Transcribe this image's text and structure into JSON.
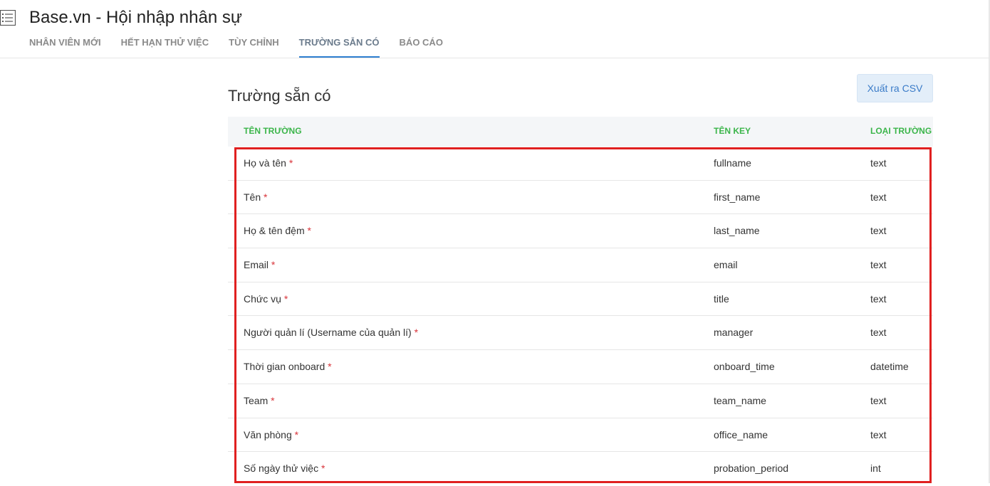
{
  "app": {
    "title": "Base.vn - Hội nhập nhân sự"
  },
  "tabs": [
    {
      "label": "NHÂN VIÊN MỚI"
    },
    {
      "label": "HẾT HẠN THỬ VIỆC"
    },
    {
      "label": "TÙY CHỈNH"
    },
    {
      "label": "TRƯỜNG SẴN CÓ",
      "active": true
    },
    {
      "label": "BÁO CÁO"
    }
  ],
  "page": {
    "title": "Trường sẵn có",
    "export_button": "Xuất ra CSV"
  },
  "table": {
    "headers": {
      "name": "TÊN TRƯỜNG",
      "key": "TÊN KEY",
      "type": "LOẠI TRƯỜNG"
    },
    "required_mark": "*",
    "rows": [
      {
        "name": "Họ và tên",
        "key": "fullname",
        "type": "text"
      },
      {
        "name": "Tên",
        "key": "first_name",
        "type": "text"
      },
      {
        "name": "Họ & tên đệm",
        "key": "last_name",
        "type": "text"
      },
      {
        "name": "Email",
        "key": "email",
        "type": "text"
      },
      {
        "name": "Chức vụ",
        "key": "title",
        "type": "text"
      },
      {
        "name": "Người quản lí (Username của quản lí)",
        "key": "manager",
        "type": "text"
      },
      {
        "name": "Thời gian onboard",
        "key": "onboard_time",
        "type": "datetime"
      },
      {
        "name": "Team",
        "key": "team_name",
        "type": "text"
      },
      {
        "name": "Văn phòng",
        "key": "office_name",
        "type": "text"
      },
      {
        "name": "Số ngày thử việc",
        "key": "probation_period",
        "type": "int"
      }
    ]
  },
  "colors": {
    "header_text": "#3bb54a",
    "required": "#d9343a",
    "active_tab_underline": "#2e7fd0",
    "highlight_box": "#e02020",
    "button_bg": "#e3eef9"
  },
  "icons": {
    "menu": "list-menu-icon"
  }
}
